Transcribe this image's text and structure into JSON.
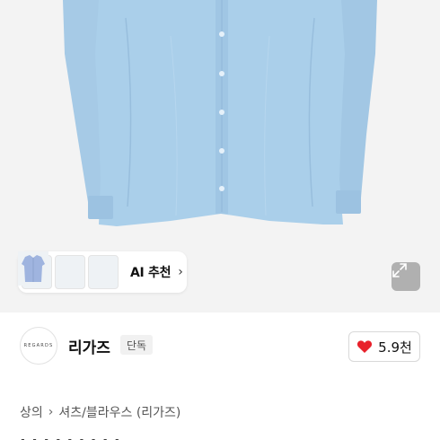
{
  "product_image": {
    "alt": "light blue button-up shirt",
    "background_color": "#f3f3f3",
    "shirt_color": "#a9cde9"
  },
  "thumbnails": [
    {
      "name": "thumb-blue-shirt",
      "color": "#9cc6ea"
    },
    {
      "name": "thumb-mint-shirt",
      "color": "#b9dcd2"
    },
    {
      "name": "thumb-periwinkle-shirt",
      "color": "#9fb4df"
    }
  ],
  "ai_recommend": {
    "label": "AI 추천",
    "chevron": "›",
    "icon": "chevron-right-icon"
  },
  "expand_button": {
    "icon": "expand-arrows-icon"
  },
  "brand": {
    "logo_text": "REGARDS",
    "name": "리가즈",
    "badge": "단독"
  },
  "like": {
    "icon": "heart-icon",
    "count": "5.9천",
    "color": "#e8212b"
  },
  "breadcrumb": {
    "items": [
      "상의",
      "셔츠/블라우스 (리가즈)"
    ],
    "separator": "›"
  },
  "title_partial": "· · · · · · · · ·"
}
